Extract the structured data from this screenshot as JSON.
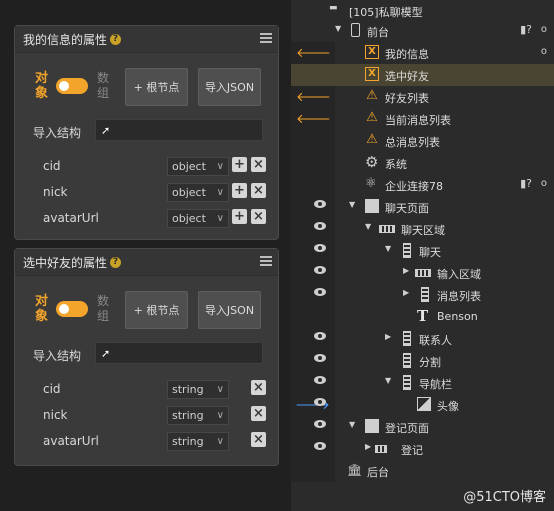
{
  "colors": {
    "accent": "#f3a42a",
    "highlight_row": "#4a4433",
    "link_arrow": "#4e9cff"
  },
  "panel1": {
    "title": "我的信息的属性",
    "object_label": "对象",
    "array_label": "数组",
    "add_root_label": "+ 根节点",
    "import_json_label": "导入JSON",
    "import_struct_label": "导入结构",
    "rows": [
      {
        "name": "cid",
        "type": "object"
      },
      {
        "name": "nick",
        "type": "object"
      },
      {
        "name": "avatarUrl",
        "type": "object"
      }
    ]
  },
  "panel2": {
    "title": "选中好友的属性",
    "object_label": "对象",
    "array_label": "数组",
    "add_root_label": "+ 根节点",
    "import_json_label": "导入JSON",
    "import_struct_label": "导入结构",
    "rows": [
      {
        "name": "cid",
        "type": "string"
      },
      {
        "name": "nick",
        "type": "string"
      },
      {
        "name": "avatarUrl",
        "type": "string"
      }
    ]
  },
  "tree": {
    "root_label": "[105]私聊模型",
    "items": [
      {
        "label": "前台",
        "icon": "phone-icon"
      },
      {
        "label": "我的信息",
        "icon": "variable-icon"
      },
      {
        "label": "选中好友",
        "icon": "variable-icon"
      },
      {
        "label": "好友列表",
        "icon": "warning-icon"
      },
      {
        "label": "当前消息列表",
        "icon": "warning-icon"
      },
      {
        "label": "总消息列表",
        "icon": "warning-icon"
      },
      {
        "label": "系统",
        "icon": "gear-icon"
      },
      {
        "label": "企业连接78",
        "icon": "connect-icon"
      },
      {
        "label": "聊天页面",
        "icon": "page-icon"
      },
      {
        "label": "聊天区域",
        "icon": "hbar-icon"
      },
      {
        "label": "聊天",
        "icon": "vbar-icon"
      },
      {
        "label": "输入区域",
        "icon": "hbar-icon"
      },
      {
        "label": "消息列表",
        "icon": "vbar-icon"
      },
      {
        "label": "Benson",
        "icon": "text-icon"
      },
      {
        "label": "联系人",
        "icon": "vbar-icon"
      },
      {
        "label": "分割",
        "icon": "vbar-icon"
      },
      {
        "label": "导航栏",
        "icon": "vbar-icon"
      },
      {
        "label": "头像",
        "icon": "image-icon"
      },
      {
        "label": "登记页面",
        "icon": "page-icon"
      },
      {
        "label": "登记",
        "icon": "hbar-icon"
      },
      {
        "label": "后台",
        "icon": "bank-icon"
      }
    ]
  },
  "watermark": "@51CTO博客"
}
